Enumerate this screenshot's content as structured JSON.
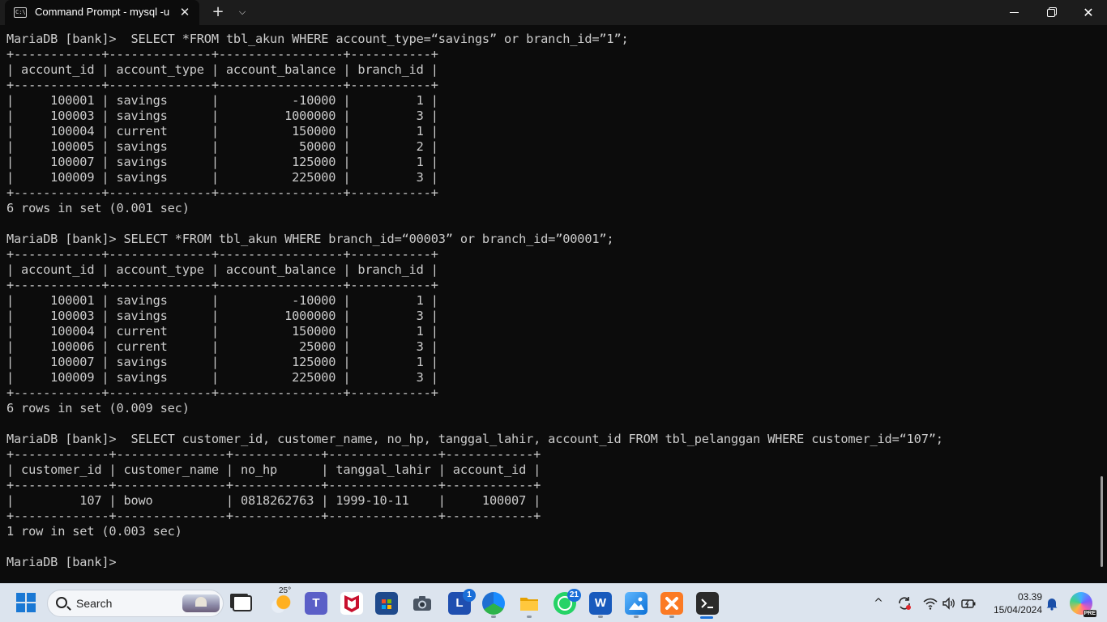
{
  "window": {
    "tab_title": "Command Prompt - mysql  -u",
    "tab_icon_text": "C:\\",
    "close_tab_glyph": "✕",
    "new_tab_glyph": "+",
    "dropdown_glyph": "⌵",
    "minimize_label": "",
    "close_glyph": "✕"
  },
  "terminal": {
    "lines": [
      "MariaDB [bank]>  SELECT *FROM tbl_akun WHERE account_type=“savings” or branch_id=”1”;",
      "+------------+--------------+-----------------+-----------+",
      "| account_id | account_type | account_balance | branch_id |",
      "+------------+--------------+-----------------+-----------+",
      "|     100001 | savings      |          -10000 |         1 |",
      "|     100003 | savings      |         1000000 |         3 |",
      "|     100004 | current      |          150000 |         1 |",
      "|     100005 | savings      |           50000 |         2 |",
      "|     100007 | savings      |          125000 |         1 |",
      "|     100009 | savings      |          225000 |         3 |",
      "+------------+--------------+-----------------+-----------+",
      "6 rows in set (0.001 sec)",
      "",
      "MariaDB [bank]> SELECT *FROM tbl_akun WHERE branch_id=“00003” or branch_id=”00001”;",
      "+------------+--------------+-----------------+-----------+",
      "| account_id | account_type | account_balance | branch_id |",
      "+------------+--------------+-----------------+-----------+",
      "|     100001 | savings      |          -10000 |         1 |",
      "|     100003 | savings      |         1000000 |         3 |",
      "|     100004 | current      |          150000 |         1 |",
      "|     100006 | current      |           25000 |         3 |",
      "|     100007 | savings      |          125000 |         1 |",
      "|     100009 | savings      |          225000 |         3 |",
      "+------------+--------------+-----------------+-----------+",
      "6 rows in set (0.009 sec)",
      "",
      "MariaDB [bank]>  SELECT customer_id, customer_name, no_hp, tanggal_lahir, account_id FROM tbl_pelanggan WHERE customer_id=“107”;",
      "+-------------+---------------+------------+---------------+------------+",
      "| customer_id | customer_name | no_hp      | tanggal_lahir | account_id |",
      "+-------------+---------------+------------+---------------+------------+",
      "|         107 | bowo          | 0818262763 | 1999-10-11    |     100007 |",
      "+-------------+---------------+------------+---------------+------------+",
      "1 row in set (0.003 sec)",
      "",
      "MariaDB [bank]>"
    ]
  },
  "taskbar": {
    "search_label": "Search",
    "weather_temp": "25°",
    "teams_letter": "T",
    "l_letter": "L",
    "l_badge": "1",
    "whatsapp_badge": "21",
    "word_letter": "W",
    "clock_time": "03.39",
    "clock_date": "15/04/2024",
    "tray_chevron": "^",
    "colors": {
      "accent": "#1a6fd8",
      "terminal_bg": "#0c0c0c",
      "terminal_fg": "#cccccc",
      "taskbar_bg": "#dce4ee"
    }
  }
}
